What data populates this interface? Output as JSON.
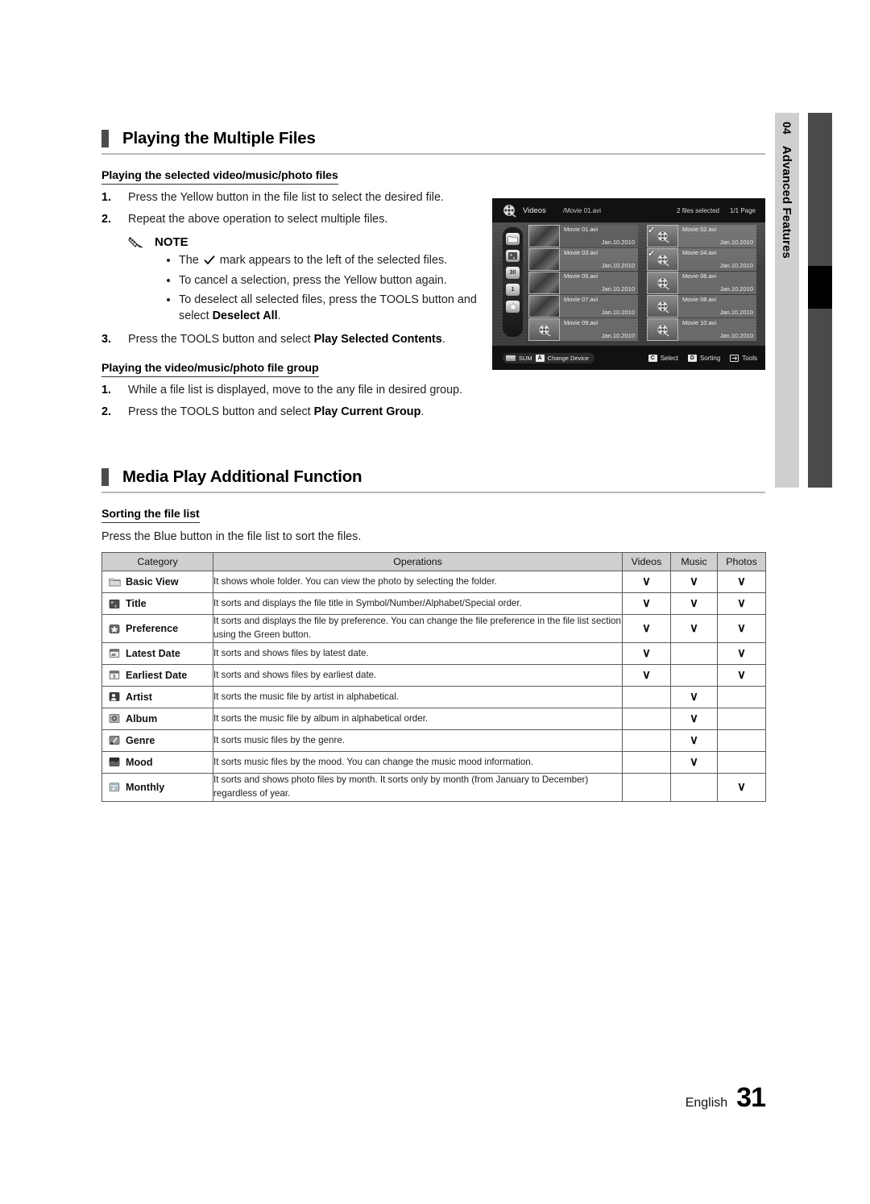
{
  "chapter_tab": {
    "number": "04",
    "name": "Advanced Features"
  },
  "sections": [
    {
      "id": "playing-multiple-files",
      "title": "Playing the Multiple Files",
      "subsections": [
        {
          "id": "selected-files",
          "heading": "Playing the selected video/music/photo files",
          "steps": [
            {
              "num": "1.",
              "text": "Press the Yellow button in the file list to select the desired file."
            },
            {
              "num": "2.",
              "text": "Repeat the above operation to select multiple files."
            },
            {
              "num": "3.",
              "text_pre": "Press the TOOLS button and select ",
              "text_bold": "Play Selected Contents",
              "text_post": "."
            }
          ],
          "note": {
            "label": "NOTE",
            "icon": "pencil-icon",
            "bullets": [
              {
                "pre": "The ",
                "check": "✓",
                "post": " mark appears to the left of the selected files."
              },
              {
                "pre": "To cancel a selection, press the Yellow button again.",
                "check": "",
                "post": ""
              },
              {
                "pre": "To deselect all selected files, press the TOOLS button and select ",
                "bold": "Deselect All",
                "post": "."
              }
            ]
          }
        },
        {
          "id": "file-group",
          "heading": "Playing the video/music/photo file group",
          "steps": [
            {
              "num": "1.",
              "text": "While a file list is displayed, move to the any file in desired group."
            },
            {
              "num": "2.",
              "text_pre": "Press the TOOLS button and select ",
              "text_bold": "Play Current Group",
              "text_post": "."
            }
          ]
        }
      ]
    },
    {
      "id": "media-play-additional",
      "title": "Media Play Additional Function",
      "subsections": [
        {
          "id": "sorting-file-list",
          "heading": "Sorting the file list",
          "paragraph": "Press the Blue button in the file list to sort the files."
        }
      ]
    }
  ],
  "sort_table": {
    "headers": [
      "Category",
      "Operations",
      "Videos",
      "Music",
      "Photos"
    ],
    "check_glyph": "∨",
    "rows": [
      {
        "icon": "folder-icon",
        "category": "Basic View",
        "operations": "It shows whole folder. You can view the photo by selecting the folder.",
        "videos": true,
        "music": true,
        "photos": true
      },
      {
        "icon": "title-az-icon",
        "category": "Title",
        "operations": "It sorts and displays the file title in Symbol/Number/Alphabet/Special order.",
        "videos": true,
        "music": true,
        "photos": true
      },
      {
        "icon": "preference-star-icon",
        "category": "Preference",
        "operations": "It sorts and displays the file by preference. You can change the file preference in the file list section using the Green button.",
        "videos": true,
        "music": true,
        "photos": true
      },
      {
        "icon": "calendar-30-icon",
        "category": "Latest Date",
        "operations": "It sorts and shows files by latest date.",
        "videos": true,
        "music": false,
        "photos": true
      },
      {
        "icon": "calendar-1-icon",
        "category": "Earliest Date",
        "operations": "It sorts and shows files by earliest date.",
        "videos": true,
        "music": false,
        "photos": true
      },
      {
        "icon": "artist-icon",
        "category": "Artist",
        "operations": "It sorts the music file by artist in alphabetical.",
        "videos": false,
        "music": true,
        "photos": false
      },
      {
        "icon": "album-icon",
        "category": "Album",
        "operations": "It sorts the music file by album in alphabetical order.",
        "videos": false,
        "music": true,
        "photos": false
      },
      {
        "icon": "genre-icon",
        "category": "Genre",
        "operations": "It sorts music files by the genre.",
        "videos": false,
        "music": true,
        "photos": false
      },
      {
        "icon": "mood-icon",
        "category": "Mood",
        "operations": "It sorts music files by the mood. You can change the music mood information.",
        "videos": false,
        "music": true,
        "photos": false
      },
      {
        "icon": "monthly-icon",
        "category": "Monthly",
        "operations": "It sorts and shows photo files by month. It sorts only by month (from January to December) regardless of year.",
        "videos": false,
        "music": false,
        "photos": true
      }
    ]
  },
  "tv_screenshot": {
    "top": {
      "logo": "film-reel-icon",
      "kind": "Videos",
      "current_file": "/Movie 01.avi",
      "selected_count": "2 files selected",
      "page": "1/1 Page"
    },
    "sidebar_icons": [
      "folder-icon",
      "title-az-icon",
      "calendar-30-icon",
      "calendar-1-icon",
      "star-icon"
    ],
    "files": [
      {
        "name": "Movie 01.avi",
        "date": "Jan.10.2010",
        "checked": false,
        "selected": true,
        "thumb": "photo"
      },
      {
        "name": "Movie 02.avi",
        "date": "Jan.10.2010",
        "checked": true,
        "selected": false,
        "thumb": "reel"
      },
      {
        "name": "Movie 03.avi",
        "date": "Jan.10.2010",
        "checked": false,
        "selected": false,
        "thumb": "photo"
      },
      {
        "name": "Movie 04.avi",
        "date": "Jan.10.2010",
        "checked": true,
        "selected": false,
        "thumb": "reel"
      },
      {
        "name": "Movie 05.avi",
        "date": "Jan.10.2010",
        "checked": false,
        "selected": false,
        "thumb": "photo"
      },
      {
        "name": "Movie 06.avi",
        "date": "Jan.10.2010",
        "checked": false,
        "selected": false,
        "thumb": "reel"
      },
      {
        "name": "Movie 07.avi",
        "date": "Jan.10.2010",
        "checked": false,
        "selected": false,
        "thumb": "photo"
      },
      {
        "name": "Movie 08.avi",
        "date": "Jan.10.2010",
        "checked": false,
        "selected": false,
        "thumb": "reel"
      },
      {
        "name": "Movie 09.avi",
        "date": "Jan.10.2010",
        "checked": false,
        "selected": false,
        "thumb": "reel"
      },
      {
        "name": "Movie 10.avi",
        "date": "Jan.10.2010",
        "checked": false,
        "selected": false,
        "thumb": "reel"
      }
    ],
    "bottom": {
      "device_label": "SUM",
      "change_device_key": "A",
      "change_device_label": "Change Device",
      "select_key": "C",
      "select_label": "Select",
      "sorting_key": "D",
      "sorting_label": "Sorting",
      "tools_label": "Tools"
    }
  },
  "footer": {
    "language": "English",
    "page": "31"
  }
}
